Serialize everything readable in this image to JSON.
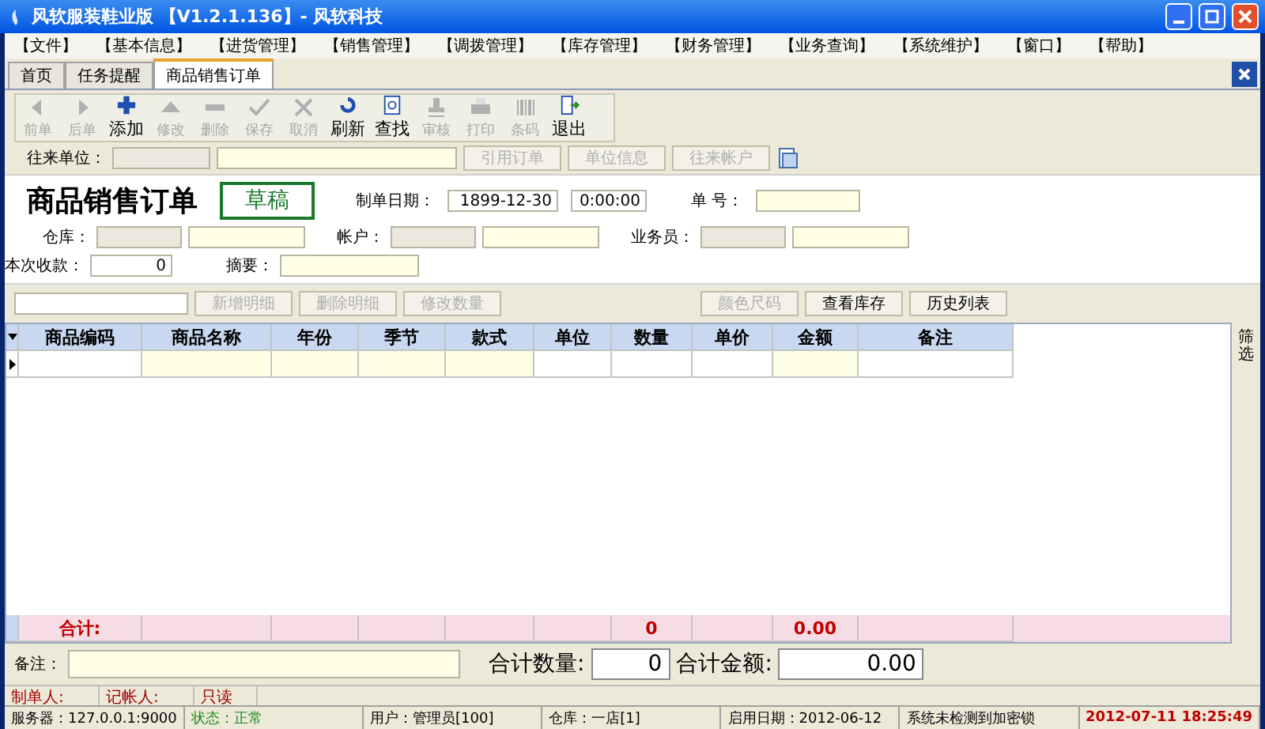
{
  "window": {
    "title": "风软服装鞋业版  【V1.2.1.136】- 风软科技"
  },
  "menu": [
    "【文件】",
    "【基本信息】",
    "【进货管理】",
    "【销售管理】",
    "【调拨管理】",
    "【库存管理】",
    "【财务管理】",
    "【业务查询】",
    "【系统维护】",
    "【窗口】",
    "【帮助】"
  ],
  "tabs": [
    {
      "label": "首页",
      "selected": false
    },
    {
      "label": "任务提醒",
      "selected": false
    },
    {
      "label": "商品销售订单",
      "selected": true
    }
  ],
  "toolbar": [
    {
      "label": "前单",
      "disabled": true
    },
    {
      "label": "后单",
      "disabled": true
    },
    {
      "label": "添加",
      "disabled": false
    },
    {
      "label": "修改",
      "disabled": true
    },
    {
      "label": "删除",
      "disabled": true
    },
    {
      "label": "保存",
      "disabled": true
    },
    {
      "label": "取消",
      "disabled": true
    },
    {
      "label": "刷新",
      "disabled": false
    },
    {
      "label": "查找",
      "disabled": false
    },
    {
      "label": "审核",
      "disabled": true
    },
    {
      "label": "打印",
      "disabled": true
    },
    {
      "label": "条码",
      "disabled": true
    },
    {
      "label": "退出",
      "disabled": false
    }
  ],
  "partner": {
    "label": "往来单位：",
    "buttons": [
      "引用订单",
      "单位信息",
      "往来帐户"
    ]
  },
  "form": {
    "title": "商品销售订单",
    "status": "草稿",
    "date_label": "制单日期：",
    "date": "1899-12-30",
    "time": "0:00:00",
    "number_label": "单    号：",
    "warehouse_label": "仓库：",
    "account_label": "帐户：",
    "clerk_label": "业务员：",
    "received_label": "本次收款：",
    "received": "0",
    "summary_label": "摘要："
  },
  "detail_buttons": [
    {
      "label": "新增明细",
      "disabled": true
    },
    {
      "label": "删除明细",
      "disabled": true
    },
    {
      "label": "修改数量",
      "disabled": true
    },
    {
      "label": "颜色尺码",
      "disabled": true
    },
    {
      "label": "查看库存",
      "disabled": false
    },
    {
      "label": "历史列表",
      "disabled": false
    }
  ],
  "table": {
    "columns": [
      "商品编码",
      "商品名称",
      "年份",
      "季节",
      "款式",
      "单位",
      "数量",
      "单价",
      "金额",
      "备注"
    ],
    "total_label": "合计:",
    "total_quantity": "0",
    "total_amount": "0.00"
  },
  "side_tab": "筛选",
  "footer": {
    "note_label": "备注：",
    "qty_label": "合计数量:",
    "qty": "0",
    "amount_label": "合计金额:",
    "amount": "0.00"
  },
  "signatures": [
    "制单人:",
    "记帐人:",
    "只读"
  ],
  "status_bar": [
    {
      "text": "服务器：127.0.0.1:9000",
      "kind": "plain"
    },
    {
      "text": "状态：正常",
      "kind": "ok"
    },
    {
      "text": "用户：管理员[100]",
      "kind": "plain"
    },
    {
      "text": "仓库：一店[1]",
      "kind": "plain"
    },
    {
      "text": "启用日期：2012-06-12",
      "kind": "plain"
    },
    {
      "text": "系统未检测到加密锁",
      "kind": "plain"
    },
    {
      "text": "2012-07-11  18:25:49",
      "kind": "clock"
    }
  ]
}
